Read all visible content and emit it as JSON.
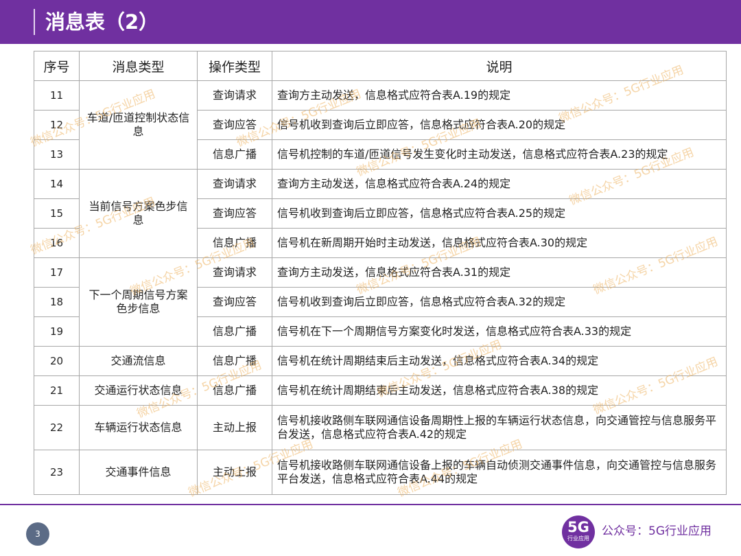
{
  "header": {
    "title": "消息表（2）"
  },
  "table": {
    "columns": [
      "序号",
      "消息类型",
      "操作类型",
      "说明"
    ],
    "groups": [
      {
        "type": "车道/匝道控制状态信息",
        "rows": [
          {
            "no": "11",
            "op": "查询请求",
            "desc": "查询方主动发送，信息格式应符合表A.19的规定"
          },
          {
            "no": "12",
            "op": "查询应答",
            "desc": "信号机收到查询后立即应答，信息格式应符合表A.20的规定"
          },
          {
            "no": "13",
            "op": "信息广播",
            "desc": "信号机控制的车道/匝道信号发生变化时主动发送，信息格式应符合表A.23的规定"
          }
        ]
      },
      {
        "type": "当前信号方案色步信息",
        "rows": [
          {
            "no": "14",
            "op": "查询请求",
            "desc": "查询方主动发送，信息格式应符合表A.24的规定"
          },
          {
            "no": "15",
            "op": "查询应答",
            "desc": "信号机收到查询后立即应答，信息格式应符合表A.25的规定"
          },
          {
            "no": "16",
            "op": "信息广播",
            "desc": "信号机在新周期开始时主动发送，信息格式应符合表A.30的规定"
          }
        ]
      },
      {
        "type": "下一个周期信号方案色步信息",
        "rows": [
          {
            "no": "17",
            "op": "查询请求",
            "desc": "查询方主动发送，信息格式应符合表A.31的规定"
          },
          {
            "no": "18",
            "op": "查询应答",
            "desc": "信号机收到查询后立即应答，信息格式应符合表A.32的规定"
          },
          {
            "no": "19",
            "op": "信息广播",
            "desc": "信号机在下一个周期信号方案变化时发送，信息格式应符合表A.33的规定"
          }
        ]
      },
      {
        "type": "交通流信息",
        "rows": [
          {
            "no": "20",
            "op": "信息广播",
            "desc": "信号机在统计周期结束后主动发送，信息格式应符合表A.34的规定"
          }
        ]
      },
      {
        "type": "交通运行状态信息",
        "rows": [
          {
            "no": "21",
            "op": "信息广播",
            "desc": "信号机在统计周期结束后主动发送，信息格式应符合表A.38的规定"
          }
        ]
      },
      {
        "type": "车辆运行状态信息",
        "rows": [
          {
            "no": "22",
            "op": "主动上报",
            "desc": "信号机接收路侧车联网通信设备周期性上报的车辆运行状态信息，向交通管控与信息服务平台发送，信息格式应符合表A.42的规定"
          }
        ]
      },
      {
        "type": "交通事件信息",
        "rows": [
          {
            "no": "23",
            "op": "主动上报",
            "desc": "信号机接收路侧车联网通信设备上报的车辆自动侦测交通事件信息，向交通管控与信息服务平台发送，信息格式应符合表A.44的规定"
          }
        ]
      }
    ]
  },
  "watermark": {
    "text": "微信公众号：5G行业应用"
  },
  "footer": {
    "page_number": "3",
    "logo_main": "5G",
    "logo_sub": "行业应用",
    "account_text": "公众号：5G行业应用"
  },
  "colors": {
    "brand_purple": "#7030a0",
    "page_circle": "#5b6b86"
  }
}
